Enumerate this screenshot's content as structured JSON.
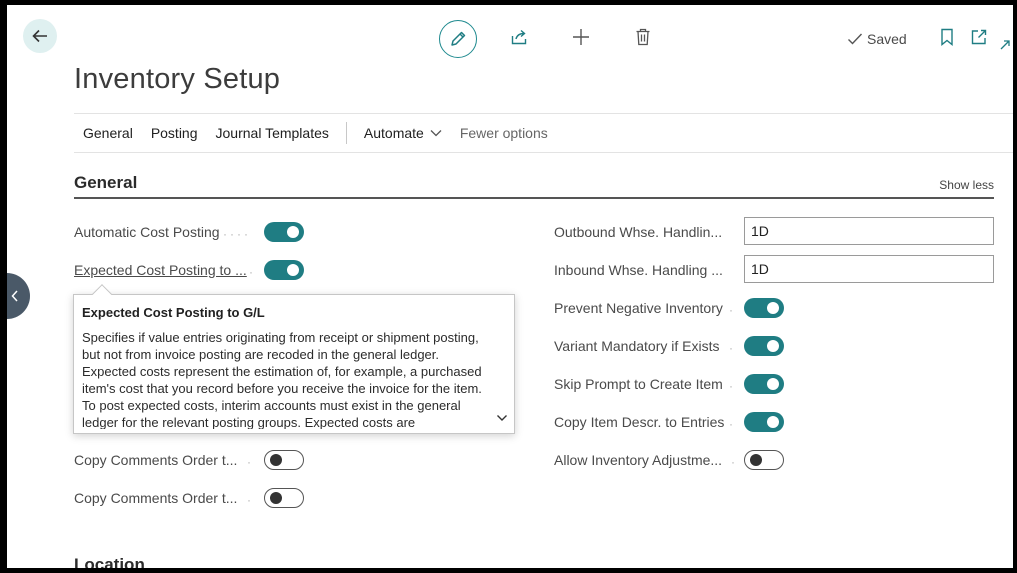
{
  "toolbar": {
    "saved_label": "Saved"
  },
  "page": {
    "title": "Inventory Setup"
  },
  "actions": {
    "general": "General",
    "posting": "Posting",
    "journal_templates": "Journal Templates",
    "automate": "Automate",
    "fewer_options": "Fewer options"
  },
  "section": {
    "title": "General",
    "show_less": "Show less",
    "next_title": "Location"
  },
  "left_fields": [
    {
      "label": "Automatic Cost Posting",
      "type": "toggle",
      "value": true
    },
    {
      "label": "Expected Cost Posting to ...",
      "type": "toggle",
      "value": true
    },
    {
      "label": "Copy Comments Order t...",
      "type": "toggle",
      "value": false
    },
    {
      "label": "Copy Comments Order t...",
      "type": "toggle",
      "value": false
    }
  ],
  "right_fields": [
    {
      "label": "Outbound Whse. Handlin...",
      "type": "text",
      "value": "1D"
    },
    {
      "label": "Inbound Whse. Handling ...",
      "type": "text",
      "value": "1D"
    },
    {
      "label": "Prevent Negative Inventory",
      "type": "toggle",
      "value": true
    },
    {
      "label": "Variant Mandatory if Exists",
      "type": "toggle",
      "value": true
    },
    {
      "label": "Skip Prompt to Create Item",
      "type": "toggle",
      "value": true
    },
    {
      "label": "Copy Item Descr. to Entries",
      "type": "toggle",
      "value": true
    },
    {
      "label": "Allow Inventory Adjustme...",
      "type": "toggle",
      "value": false
    }
  ],
  "tooltip": {
    "title": "Expected Cost Posting to G/L",
    "body": "Specifies if value entries originating from receipt or shipment posting, but not from invoice posting are recoded in the general ledger. Expected costs represent the estimation of, for example, a purchased item's cost that you record before you receive the invoice for the item. To post expected costs, interim accounts must exist in the general ledger for the relevant posting groups. Expected costs are"
  },
  "icons": {
    "back": "back-arrow-icon",
    "edit": "pencil-icon",
    "share": "share-icon",
    "add": "plus-icon",
    "delete": "trash-icon",
    "saved": "checkmark-icon",
    "bookmark": "bookmark-icon",
    "open_new": "open-in-new-window-icon",
    "collapse": "collapse-arrow-icon",
    "chevron": "chevron-down-icon",
    "side_panel": "chevron-left-icon"
  },
  "colors": {
    "accent": "#1f7d83",
    "back_bg": "#dff0f0",
    "side_tab": "#4a5968"
  }
}
